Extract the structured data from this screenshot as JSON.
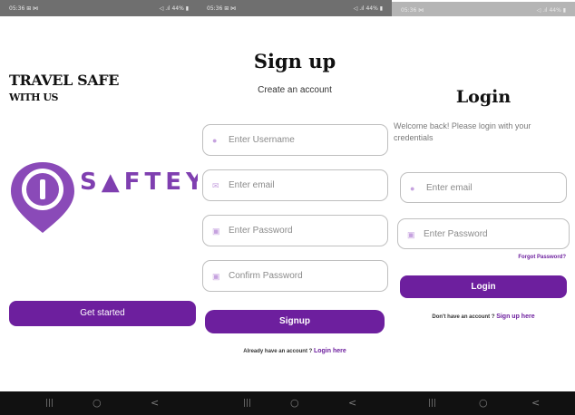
{
  "status_bars": {
    "s1": {
      "time": "05:36 ⊞ ⋈",
      "signal": "◁ .ıl 44% ▮"
    },
    "s2": {
      "time": "05:36 ⊞ ⋈",
      "signal": "◁ .ıl 44% ▮"
    },
    "s3": {
      "time": "05:36 ⋈",
      "signal": "◁ .ıl 44% ▮"
    }
  },
  "nav": {
    "recent": "|||",
    "home": "○",
    "back": "<"
  },
  "welcome_screen": {
    "headline_line1": "TRAVEL SAFE",
    "headline_line2": "WITH US",
    "brand_text": "S▲FTEY",
    "cta_label": "Get started"
  },
  "signup_screen": {
    "title": "Sign up",
    "subtitle": "Create an account",
    "fields": [
      {
        "icon": "user-icon",
        "placeholder": "Enter Username"
      },
      {
        "icon": "mail-icon",
        "placeholder": "Enter email"
      },
      {
        "icon": "lock-icon",
        "placeholder": "Enter Password"
      },
      {
        "icon": "lock-icon",
        "placeholder": "Confirm Password"
      }
    ],
    "button_label": "Signup",
    "have_account_text": "Already have an account ?",
    "login_link": "Login here"
  },
  "login_screen": {
    "title": "Login",
    "welcome_text": "Welcome back! Please login with your credentials",
    "fields": [
      {
        "icon": "user-icon",
        "placeholder": "Enter email"
      },
      {
        "icon": "lock-icon",
        "placeholder": "Enter Password"
      }
    ],
    "forgot_link": "Forgot Password?",
    "button_label": "Login",
    "no_account_text": "Don't have an account ?",
    "signup_link": "Sign up here"
  },
  "colors": {
    "accent": "#6d1f9e",
    "logo_purple": "#8a4ab8"
  }
}
